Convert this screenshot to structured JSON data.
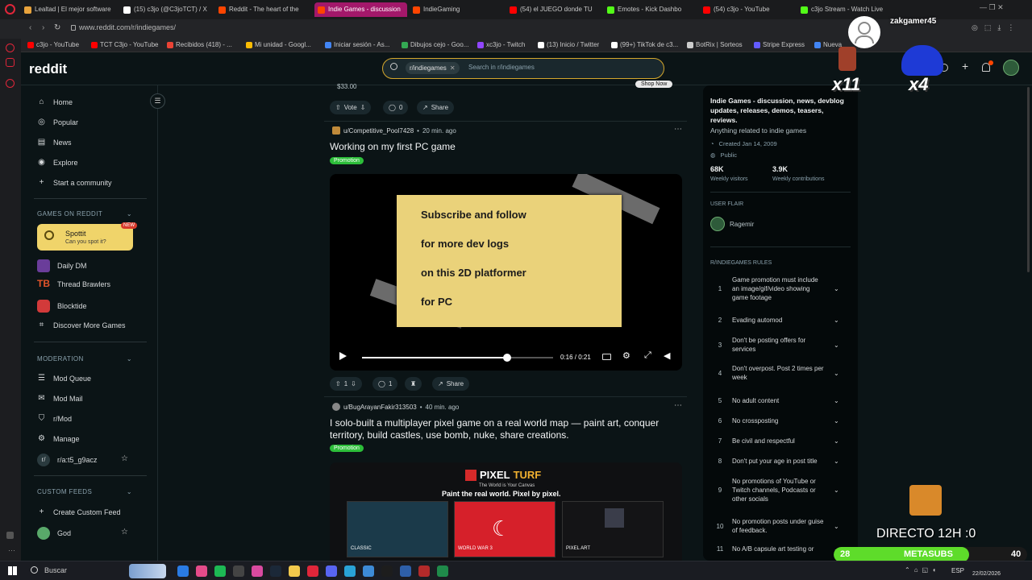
{
  "browser": {
    "tabs": [
      {
        "label": "Lealtad | El mejor software",
        "color": "#e8a33c"
      },
      {
        "label": "(15) c3jo (@C3joTCT) / X",
        "color": "#ffffff"
      },
      {
        "label": "Reddit - The heart of the",
        "color": "#ff4500"
      },
      {
        "label": "Indie Games - discussion",
        "color": "#ff4500"
      },
      {
        "label": "IndieGaming",
        "color": "#ff4500"
      },
      {
        "label": "(54) el JUEGO donde TU",
        "color": "#ff0000"
      },
      {
        "label": "Emotes - Kick Dashbo",
        "color": "#53fc18"
      },
      {
        "label": "(54) c3jo - YouTube",
        "color": "#ff0000"
      },
      {
        "label": "c3jo Stream - Watch Live",
        "color": "#53fc18"
      }
    ],
    "url": "www.reddit.com/r/indiegames/",
    "bookmarks": [
      {
        "label": "c3jo - YouTube",
        "color": "#ff0000"
      },
      {
        "label": "TCT C3jo - YouTube",
        "color": "#ff0000"
      },
      {
        "label": "Recibidos (418) - ...",
        "color": "#ea4335"
      },
      {
        "label": "Mi unidad - Googl...",
        "color": "#fbbc04"
      },
      {
        "label": "Iniciar sesión - As...",
        "color": "#4285f4"
      },
      {
        "label": "Dibujos cejo - Goo...",
        "color": "#34a853"
      },
      {
        "label": "xc3jo - Twitch",
        "color": "#9146ff"
      },
      {
        "label": "(13) Inicio / Twitter",
        "color": "#ffffff"
      },
      {
        "label": "(99+) TikTok de c3...",
        "color": "#ffffff"
      },
      {
        "label": "BotRix | Sorteos",
        "color": "#cccccc"
      },
      {
        "label": "Stripe Express",
        "color": "#635bff"
      },
      {
        "label": "Nueva",
        "color": "#4285f4"
      }
    ]
  },
  "reddit": {
    "logo": "reddit",
    "search": {
      "chip": "r/indiegames",
      "placeholder": "Search in r/indiegames"
    },
    "sidebar": {
      "main": [
        "Home",
        "Popular",
        "News",
        "Explore",
        "Start a community"
      ],
      "games_title": "GAMES ON REDDIT",
      "spottit": {
        "name": "Spottit",
        "sub": "Can you spot it?",
        "badge": "NEW"
      },
      "games": [
        "Daily DM",
        "Thread Brawlers",
        "Blocktide",
        "Discover More Games"
      ],
      "moderation_title": "MODERATION",
      "moderation": [
        "Mod Queue",
        "Mod Mail",
        "r/Mod",
        "Manage",
        "r/a:t5_g9acz"
      ],
      "custom_title": "CUSTOM FEEDS",
      "custom": [
        "Create Custom Feed",
        "God"
      ]
    },
    "prev_post": {
      "price": "$33.00",
      "shop": "Shop Now",
      "vote": "Vote",
      "comments": "0",
      "share": "Share"
    },
    "post1": {
      "user": "u/Competitive_Pool7428",
      "time": "20 min. ago",
      "title": "Working on my first PC game",
      "flair": "Promotion",
      "note_lines": [
        "Subscribe and follow",
        "for more dev logs",
        "on this 2D platformer",
        "for PC"
      ],
      "time_display": "0:16 / 0:21",
      "progress": 0.76,
      "votes": "1",
      "comments": "1",
      "share": "Share"
    },
    "post2": {
      "user": "u/BugArayanFakir313503",
      "time": "40 min. ago",
      "title": "I solo-built a multiplayer pixel game on a real world map — paint art, conquer territory, build castles, use bomb, nuke, share creations.",
      "flair": "Promotion",
      "brand_a": "PIXEL",
      "brand_b": "TURF",
      "tagline_small": "The World is Your Canvas",
      "tagline": "Paint the real world. Pixel by pixel.",
      "modes": [
        "CLASSIC",
        "WORLD WAR 3",
        "PIXEL ART"
      ]
    },
    "about": {
      "title": "Indie Games - discussion, news, devblog updates, releases, demos, teasers, reviews.",
      "desc": "Anything related to indie games",
      "created": "Created Jan 14, 2009",
      "visibility": "Public",
      "visitors": "68K",
      "visitors_label": "Weekly visitors",
      "contrib": "3.9K",
      "contrib_label": "Weekly contributions",
      "flair_title": "USER FLAIR",
      "flair_user": "Ragemir",
      "rules_title": "R/INDIEGAMES RULES",
      "rules": [
        "Game promotion must include an image/gif/video showing game footage",
        "Evading automod",
        "Don't be posting offers for services",
        "Don't overpost. Post 2 times per week",
        "No adult content",
        "No crossposting",
        "Be civil and respectful",
        "Don't put your age in post title",
        "No promotions of YouTube or Twitch channels, Podcasts or other socials",
        "No promotion posts under guise of feedback.",
        "No A/B capsule art testing or"
      ]
    }
  },
  "overlay": {
    "username": "zakgamer45",
    "x11": "x11",
    "x4": "x4",
    "directo": "DIRECTO 12H :0",
    "meta_left": "28",
    "meta_label": "METASUBS",
    "meta_right": "40",
    "meta_progress": 0.7
  },
  "taskbar": {
    "search": "Buscar",
    "lang": "ESP",
    "date": "22/02/2026"
  }
}
